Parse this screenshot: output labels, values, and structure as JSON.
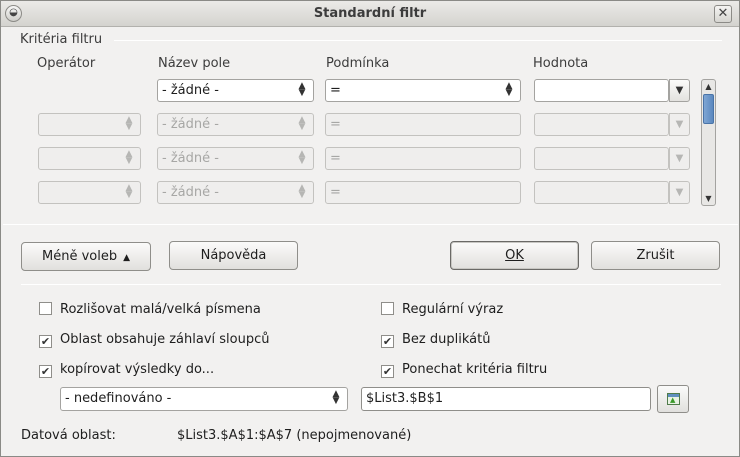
{
  "window": {
    "title": "Standardní filtr",
    "menu_glyph": "◒",
    "close_glyph": "✕"
  },
  "criteria": {
    "section_title": "Kritéria filtru",
    "headers": {
      "operator": "Operátor",
      "field_name": "Název pole",
      "condition": "Podmínka",
      "value": "Hodnota"
    },
    "rows": [
      {
        "operator": "",
        "field": "- žádné -",
        "condition": "=",
        "value": "",
        "enabled": true
      },
      {
        "operator": "",
        "field": "- žádné -",
        "condition": "=",
        "value": "",
        "enabled": false
      },
      {
        "operator": "",
        "field": "- žádné -",
        "condition": "=",
        "value": "",
        "enabled": false
      },
      {
        "operator": "",
        "field": "- žádné -",
        "condition": "=",
        "value": "",
        "enabled": false
      }
    ]
  },
  "buttons": {
    "fewer_options": "Méně voleb",
    "help": "Nápověda",
    "ok": "OK",
    "cancel": "Zrušit"
  },
  "options": {
    "case_sensitive": {
      "label": "Rozlišovat malá/velká písmena",
      "checked": false
    },
    "regex": {
      "label": "Regulární výraz",
      "checked": false
    },
    "range_has_headers": {
      "label": "Oblast obsahuje záhlaví sloupců",
      "checked": true
    },
    "no_duplicates": {
      "label": "Bez duplikátů",
      "checked": true
    },
    "copy_results": {
      "label": "kopírovat výsledky do...",
      "checked": true
    },
    "keep_criteria": {
      "label": "Ponechat kritéria filtru",
      "checked": true
    }
  },
  "copy_target": {
    "named_range": "- nedefinováno -",
    "reference": "$List3.$B$1"
  },
  "data_range": {
    "label": "Datová oblast:",
    "value": "$List3.$A$1:$A$7 (nepojmenované)"
  },
  "icons": {
    "spin": "⌃⌄",
    "dropdown": "⌄",
    "check": "✔",
    "collapse_arrows": "▲▼"
  },
  "colors": {
    "window_bg": "#f2f1f0",
    "scroll_thumb": "#5b88bf",
    "disabled_text": "#a7a7a5"
  }
}
